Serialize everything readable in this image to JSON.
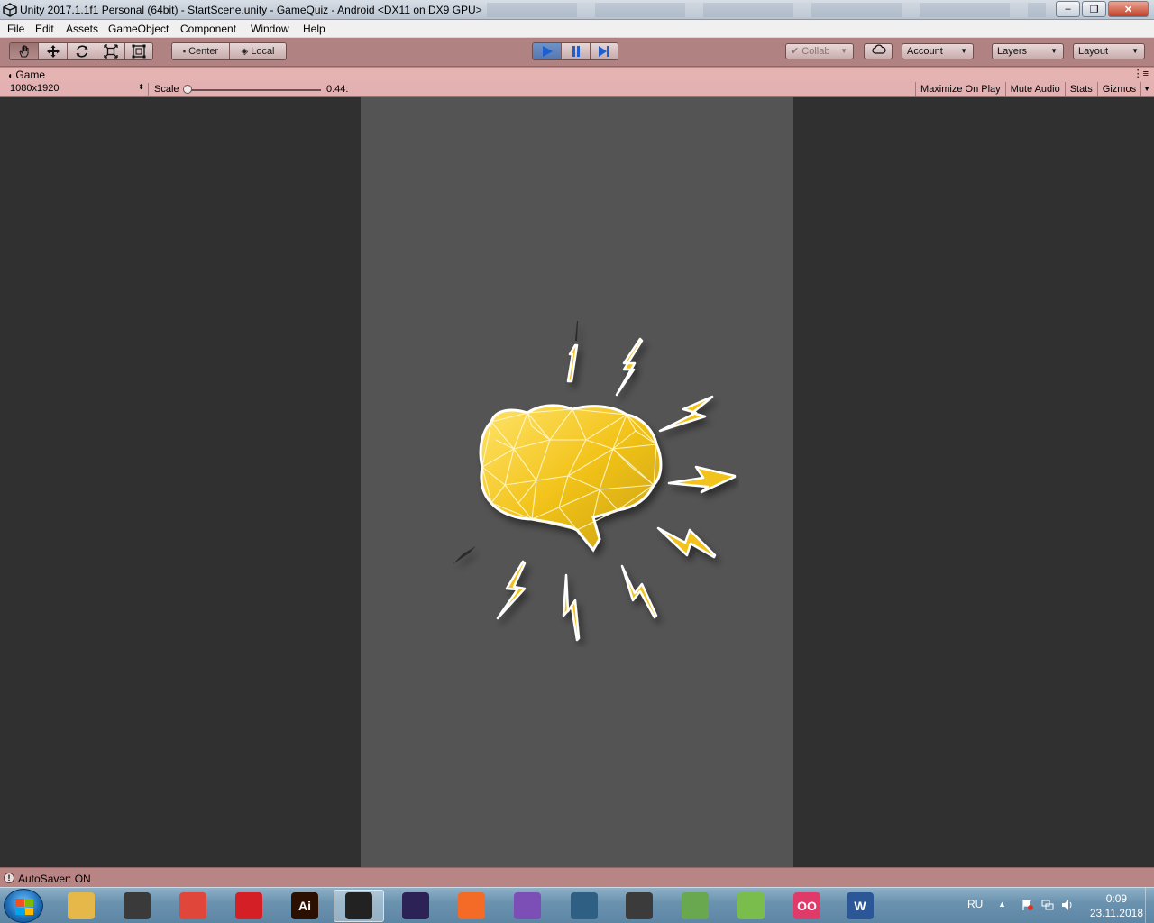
{
  "window": {
    "title": "Unity 2017.1.1f1 Personal (64bit) - StartScene.unity - GameQuiz - Android <DX11 on DX9 GPU>",
    "minimize_label": "–",
    "maximize_label": "❐",
    "close_label": "✕"
  },
  "menu": {
    "items": [
      "File",
      "Edit",
      "Assets",
      "GameObject",
      "Component",
      "Window",
      "Help"
    ]
  },
  "toolbar": {
    "tools": [
      "hand-icon",
      "move-icon",
      "rotate-icon",
      "scale-icon",
      "rect-icon"
    ],
    "pivot_mode": "Center",
    "pivot_rotation": "Local",
    "collab": "Collab",
    "account": "Account",
    "layers": "Layers",
    "layout": "Layout"
  },
  "game_tab": {
    "label": "Game",
    "resolution": "1080x1920",
    "scale_label": "Scale",
    "scale_value": "0.44:",
    "scale_fraction": 0.02,
    "right_buttons": [
      "Maximize On Play",
      "Mute Audio",
      "Stats",
      "Gizmos"
    ]
  },
  "status": {
    "message": "AutoSaver: ON"
  },
  "taskbar": {
    "apps": [
      {
        "name": "file-explorer",
        "label": "",
        "color": "#e6b84a"
      },
      {
        "name": "aimp",
        "label": "",
        "color": "#3a3a3a"
      },
      {
        "name": "chrome",
        "label": "",
        "color": "#e0463a"
      },
      {
        "name": "opera",
        "label": "",
        "color": "#d41f26"
      },
      {
        "name": "illustrator",
        "label": "Ai",
        "color": "#2b0f00"
      },
      {
        "name": "unity",
        "label": "",
        "color": "#222222"
      },
      {
        "name": "eclipse",
        "label": "",
        "color": "#2c2255"
      },
      {
        "name": "sublime",
        "label": "",
        "color": "#f36b26"
      },
      {
        "name": "visual-studio",
        "label": "",
        "color": "#7b4fb5"
      },
      {
        "name": "mysql-workbench",
        "label": "",
        "color": "#2f5f82"
      },
      {
        "name": "world-of-tanks",
        "label": "",
        "color": "#3b3b3b"
      },
      {
        "name": "wifi-app",
        "label": "",
        "color": "#6aa84f"
      },
      {
        "name": "android-studio",
        "label": "",
        "color": "#7bbd4c"
      },
      {
        "name": "flickr-like",
        "label": "OO",
        "color": "#e03a6a"
      },
      {
        "name": "word",
        "label": "W",
        "color": "#2b5797"
      }
    ],
    "language": "RU",
    "time": "0:09",
    "date": "23.11.2018"
  },
  "colors": {
    "toolbar_bg": "#b08282",
    "game_bg": "#303030",
    "canvas_bg": "#545454",
    "brain": "#f2c31a"
  }
}
